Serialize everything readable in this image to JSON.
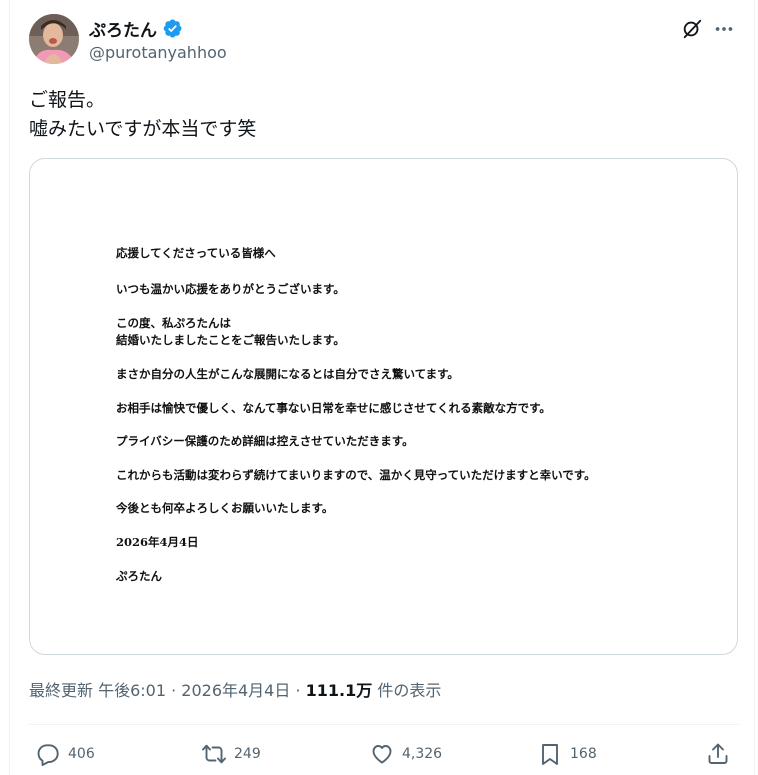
{
  "user": {
    "display_name": "ぷろたん",
    "handle": "@purotanyahhoo",
    "verified": true
  },
  "tweet": {
    "lines": [
      "ご報告。",
      "嘘みたいですが本当です笑"
    ]
  },
  "letter": {
    "paragraphs": [
      "応援してくださっている皆様へ",
      "いつも温かい応援をありがとうございます。",
      "この度、私ぷろたんは",
      "結婚いたしましたことをご報告いたします。",
      "まさか自分の人生がこんな展開になるとは自分でさえ驚いてます。",
      "お相手は愉快で優しく、なんて事ない日常を幸せに感じさせてくれる素敵な方です。",
      "プライバシー保護のため詳細は控えさせていただきます。",
      "これからも活動は変わらず続けてまいりますので、温かく見守っていただけますと幸いです。",
      "今後とも何卒よろしくお願いいたします。",
      "2026年4月4日",
      "ぷろたん"
    ]
  },
  "meta": {
    "prefix": "最終更新 午後6:01 · 2026年4月4日 · ",
    "views_count": "111.1万",
    "views_suffix": " 件の表示"
  },
  "actions": {
    "replies": "406",
    "reposts": "249",
    "likes": "4,326",
    "bookmarks": "168"
  },
  "icons": {
    "header": [
      "grok-icon",
      "more-icon"
    ],
    "actions": [
      "reply-icon",
      "repost-icon",
      "like-icon",
      "bookmark-icon",
      "share-icon"
    ]
  },
  "colors": {
    "text": "#0f1419",
    "secondary": "#536471",
    "verified": "#1d9bf0",
    "border": "#cfd9de"
  }
}
